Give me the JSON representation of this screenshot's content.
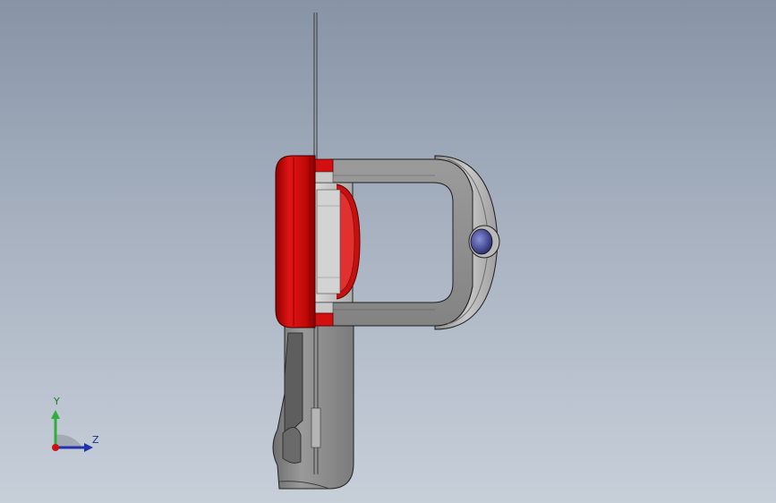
{
  "viewport": {
    "background_top": "#8794a6",
    "background_bottom": "#c7cfd9"
  },
  "model": {
    "name": "",
    "colors": {
      "body": "#8f8f8f",
      "body_dark": "#5a5a5a",
      "ring_red": "#d10a0a",
      "ring_red_dark": "#8a0000",
      "knob_blue": "#3a3f8a"
    }
  },
  "triad": {
    "y_label": "Y",
    "z_label": "Z",
    "y_color": "#2fae3c",
    "z_color": "#2233aa",
    "x_color": "#cc1111",
    "icons": [
      "axis-triad-icon"
    ]
  }
}
